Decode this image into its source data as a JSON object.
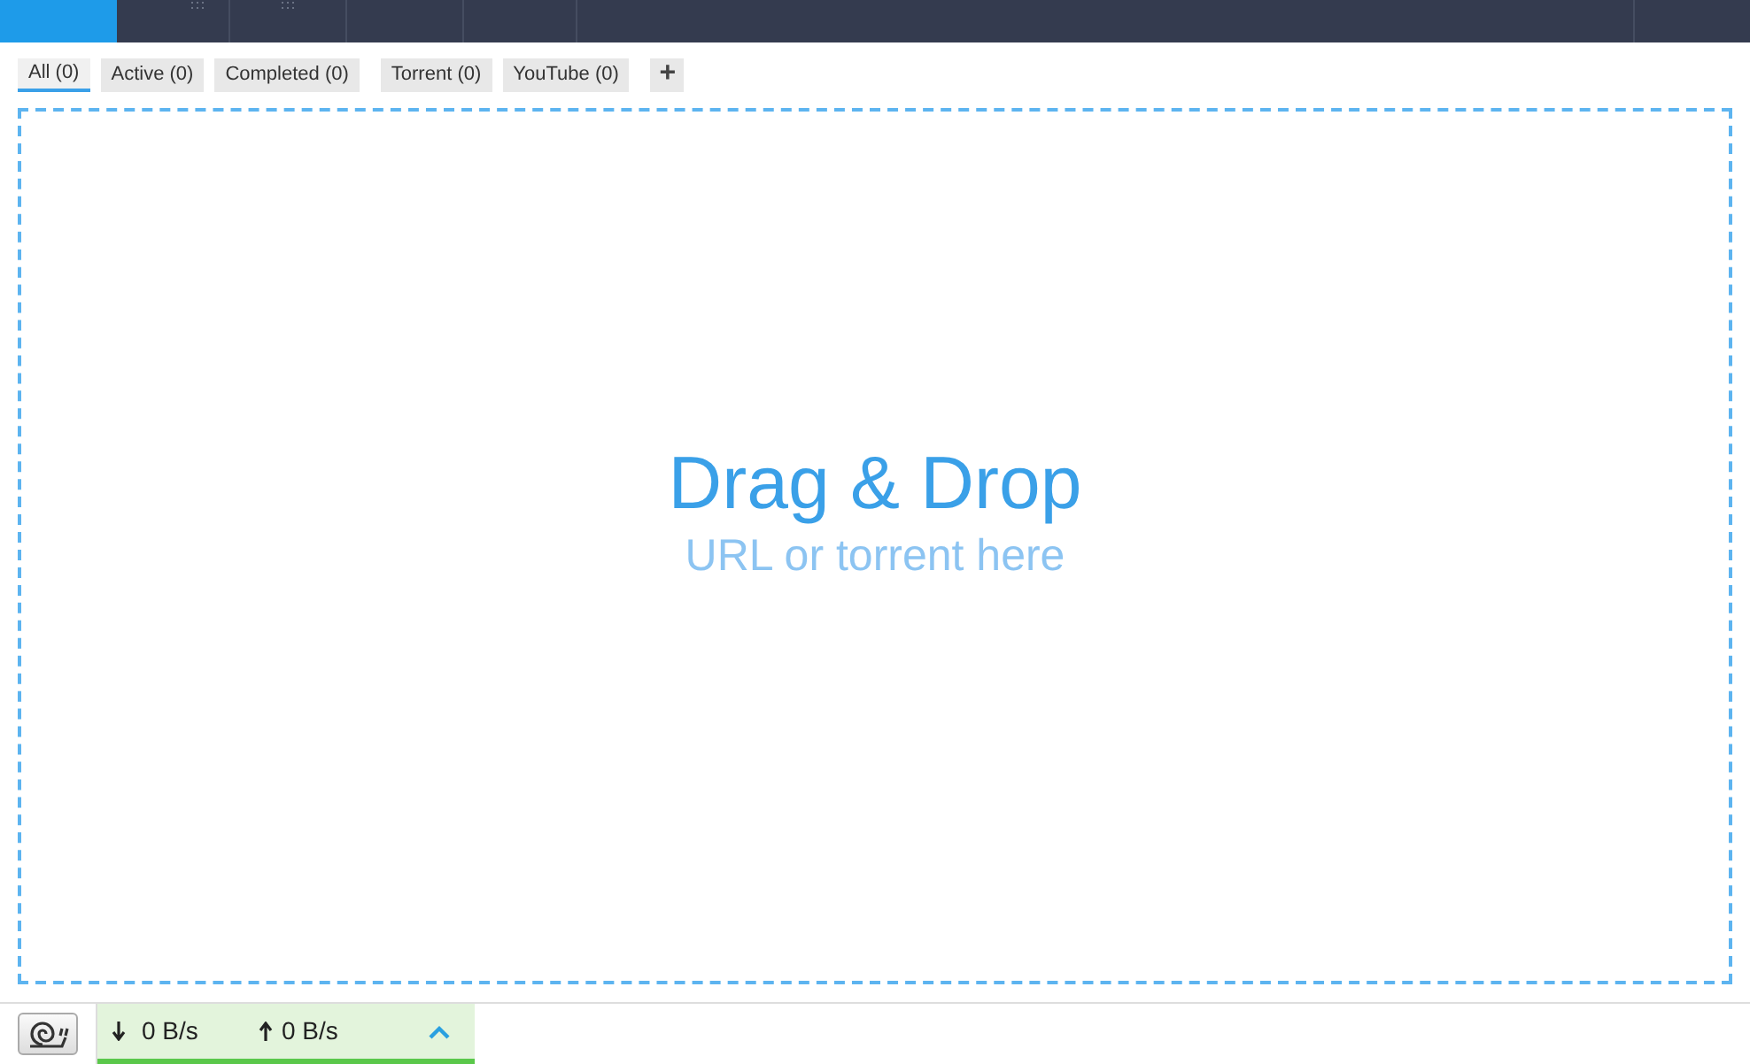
{
  "filters": [
    {
      "label": "All (0)",
      "selected": true
    },
    {
      "label": "Active (0)",
      "selected": false
    },
    {
      "label": "Completed (0)",
      "selected": false
    },
    {
      "label": "Torrent (0)",
      "selected": false
    },
    {
      "label": "YouTube (0)",
      "selected": false
    }
  ],
  "add_filter": "+",
  "drop_zone": {
    "title": "Drag & Drop",
    "subtitle": "URL or torrent here"
  },
  "status_bar": {
    "download": "0 B/s",
    "upload": "0 B/s"
  }
}
